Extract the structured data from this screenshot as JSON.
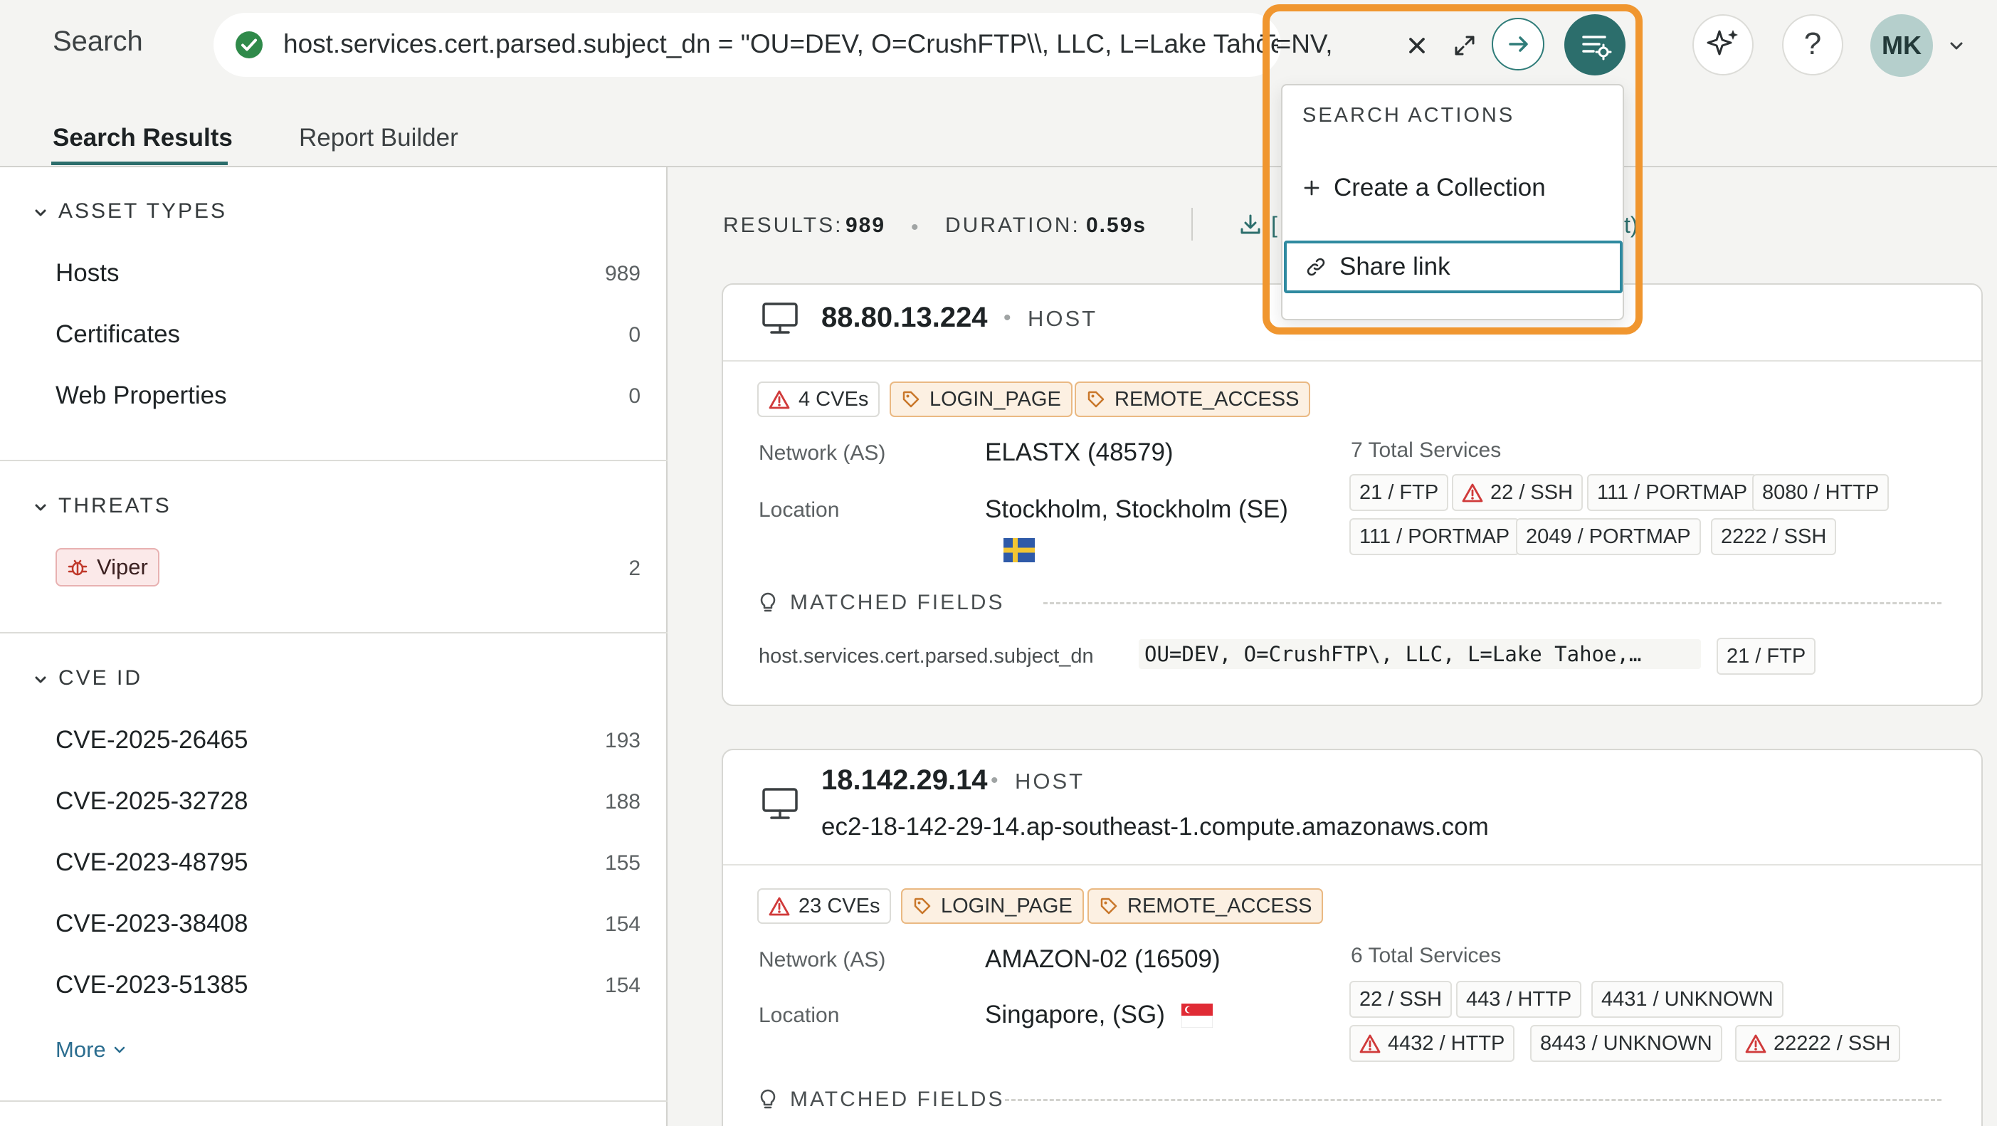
{
  "header": {
    "search_label": "Search",
    "query_text": "host.services.cert.parsed.subject_dn = \"OU=DEV, O=CrushFTP\\\\, LLC, L=Lake Tahoe, S",
    "query_tail": "T=NV,",
    "avatar_initials": "MK",
    "help_glyph": "?"
  },
  "tabs": [
    {
      "label": "Search Results",
      "active": true
    },
    {
      "label": "Report Builder",
      "active": false
    }
  ],
  "sidebar": {
    "asset_types": {
      "heading": "ASSET TYPES",
      "items": [
        {
          "label": "Hosts",
          "count": "989"
        },
        {
          "label": "Certificates",
          "count": "0"
        },
        {
          "label": "Web Properties",
          "count": "0"
        }
      ]
    },
    "threats": {
      "heading": "THREATS",
      "items": [
        {
          "label": "Viper",
          "count": "2"
        }
      ]
    },
    "cve_id": {
      "heading": "CVE ID",
      "items": [
        {
          "label": "CVE-2025-26465",
          "count": "193"
        },
        {
          "label": "CVE-2025-32728",
          "count": "188"
        },
        {
          "label": "CVE-2023-48795",
          "count": "155"
        },
        {
          "label": "CVE-2023-38408",
          "count": "154"
        },
        {
          "label": "CVE-2023-51385",
          "count": "154"
        }
      ],
      "more_label": "More"
    }
  },
  "results_bar": {
    "results_label": "RESULTS:",
    "results_value": "989",
    "duration_label": "DURATION:",
    "duration_value": "0.59s",
    "partial_left": "[",
    "partial_right": "t)"
  },
  "cards": [
    {
      "ip": "88.80.13.224",
      "type_label": "HOST",
      "hostname": "",
      "cves": "4 CVEs",
      "tags": [
        "LOGIN_PAGE",
        "REMOTE_ACCESS"
      ],
      "network_label": "Network (AS)",
      "network_value": "ELASTX (48579)",
      "location_label": "Location",
      "location_value": "Stockholm, Stockholm (SE)",
      "services_head": "7 Total Services",
      "services": [
        {
          "label": "21 / FTP",
          "warn": false
        },
        {
          "label": "22 / SSH",
          "warn": true
        },
        {
          "label": "111 / PORTMAP",
          "warn": false
        },
        {
          "label": "8080 / HTTP",
          "warn": false
        },
        {
          "label": "111 / PORTMAP",
          "warn": false
        },
        {
          "label": "2049 / PORTMAP",
          "warn": false
        },
        {
          "label": "2222 / SSH",
          "warn": false
        }
      ],
      "matched_head": "MATCHED FIELDS",
      "matched_field": "host.services.cert.parsed.subject_dn",
      "matched_value": "OU=DEV, O=CrushFTP\\, LLC, L=Lake Tahoe,…",
      "matched_service": "21 / FTP"
    },
    {
      "ip": "18.142.29.14",
      "type_label": "HOST",
      "hostname": "ec2-18-142-29-14.ap-southeast-1.compute.amazonaws.com",
      "cves": "23 CVEs",
      "tags": [
        "LOGIN_PAGE",
        "REMOTE_ACCESS"
      ],
      "network_label": "Network (AS)",
      "network_value": "AMAZON-02 (16509)",
      "location_label": "Location",
      "location_value": "Singapore, (SG)",
      "services_head": "6 Total Services",
      "services": [
        {
          "label": "22 / SSH",
          "warn": false
        },
        {
          "label": "443 / HTTP",
          "warn": false
        },
        {
          "label": "4431 / UNKNOWN",
          "warn": false
        },
        {
          "label": "4432 / HTTP",
          "warn": true
        },
        {
          "label": "8443 / UNKNOWN",
          "warn": false
        },
        {
          "label": "22222 / SSH",
          "warn": true
        }
      ],
      "matched_head": "MATCHED FIELDS"
    }
  ],
  "dropdown": {
    "title": "SEARCH ACTIONS",
    "create_label": "Create a Collection",
    "share_label": "Share link"
  },
  "colors": {
    "accent": "#2c6e6c",
    "highlight": "#f0962f",
    "warn": "#d03a3a"
  },
  "icons": [
    "check-circle-icon",
    "close-icon",
    "expand-icon",
    "arrow-right-icon",
    "search-actions-icon",
    "sparkle-icon",
    "chevron-down-icon",
    "monitor-icon",
    "warning-icon",
    "tag-icon",
    "bug-icon",
    "lightbulb-icon",
    "download-icon",
    "plus-icon",
    "link-icon",
    "flag-se-icon",
    "flag-sg-icon"
  ]
}
